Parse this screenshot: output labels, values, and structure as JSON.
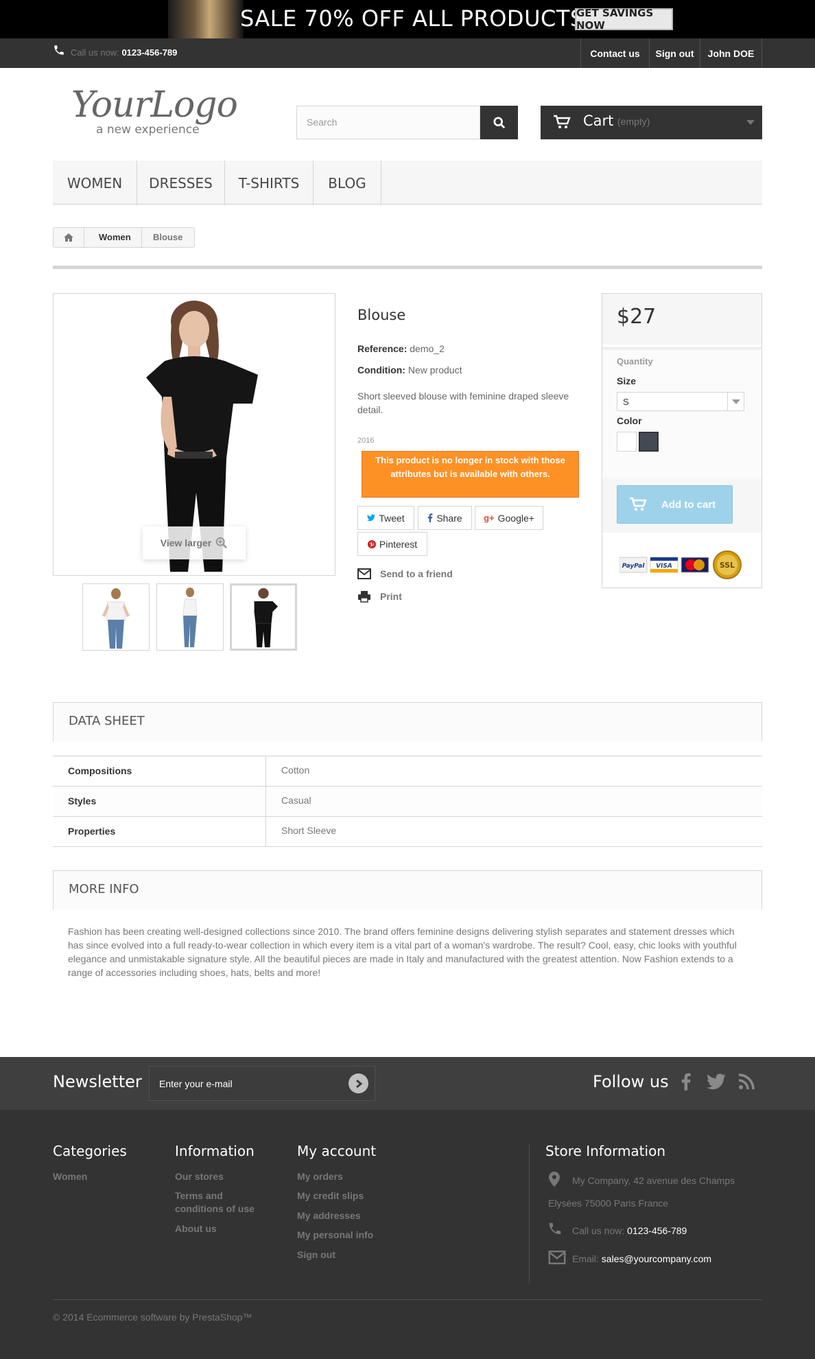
{
  "banner": {
    "title": "SALE 70% OFF ALL PRODUCTS",
    "button": "GET SAVINGS NOW"
  },
  "topbar": {
    "call_label": "Call us now:",
    "phone": "0123-456-789",
    "links": [
      "Contact us",
      "Sign out",
      "John DOE"
    ]
  },
  "logo": {
    "name": "YourLogo",
    "tagline": "a new experience"
  },
  "search": {
    "placeholder": "Search"
  },
  "cart": {
    "label": "Cart",
    "status": "(empty)"
  },
  "menu": [
    "WOMEN",
    "DRESSES",
    "T-SHIRTS",
    "BLOG"
  ],
  "breadcrumb": [
    "Women",
    "Blouse"
  ],
  "product": {
    "view_larger": "View larger",
    "name": "Blouse",
    "reference_label": "Reference:",
    "reference": "demo_2",
    "condition_label": "Condition:",
    "condition": "New product",
    "description": "Short sleeved blouse with feminine draped sleeve detail.",
    "faded_text": "2016",
    "stock_alert": "This product is no longer in stock with those attributes but is available with others.",
    "share": [
      "Tweet",
      "Share",
      "Google+",
      "Pinterest"
    ],
    "send_friend": "Send to a friend",
    "print": "Print"
  },
  "buybox": {
    "price": "$27",
    "quantity_label": "Quantity",
    "size_label": "Size",
    "size_value": "S",
    "color_label": "Color",
    "colors": [
      "#ffffff",
      "#434a54"
    ],
    "add_to_cart": "Add to cart",
    "payment_logos": [
      "PayPal",
      "VISA",
      "MasterCard",
      "SSL"
    ]
  },
  "datasheet": {
    "title": "DATA SHEET",
    "rows": [
      {
        "key": "Compositions",
        "value": "Cotton"
      },
      {
        "key": "Styles",
        "value": "Casual"
      },
      {
        "key": "Properties",
        "value": "Short Sleeve"
      }
    ]
  },
  "moreinfo": {
    "title": "MORE INFO",
    "text": "Fashion has been creating well-designed collections since 2010. The brand offers feminine designs delivering stylish separates and statement dresses which has since evolved into a full ready-to-wear collection in which every item is a vital part of a woman's wardrobe. The result? Cool, easy, chic looks with youthful elegance and unmistakable signature style. All the beautiful pieces are made in Italy and manufactured with the greatest attention. Now Fashion extends to a range of accessories including shoes, hats, belts and more!"
  },
  "newsletter": {
    "title": "Newsletter",
    "placeholder": "Enter your e-mail",
    "follow": "Follow us"
  },
  "footer": {
    "categories": {
      "title": "Categories",
      "links": [
        "Women"
      ]
    },
    "information": {
      "title": "Information",
      "links": [
        "Our stores",
        "Terms and conditions of use",
        "About us"
      ]
    },
    "account": {
      "title": "My account",
      "links": [
        "My orders",
        "My credit slips",
        "My addresses",
        "My personal info",
        "Sign out"
      ]
    },
    "store": {
      "title": "Store Information",
      "address_line1": "My Company, 42 avenue des Champs",
      "address_line2": "Elysées 75000 Paris France",
      "call_label": "Call us now:",
      "phone": "0123-456-789",
      "email_label": "Email:",
      "email": "sales@yourcompany.com"
    },
    "copyright": "© 2014 Ecommerce software by PrestaShop™"
  }
}
